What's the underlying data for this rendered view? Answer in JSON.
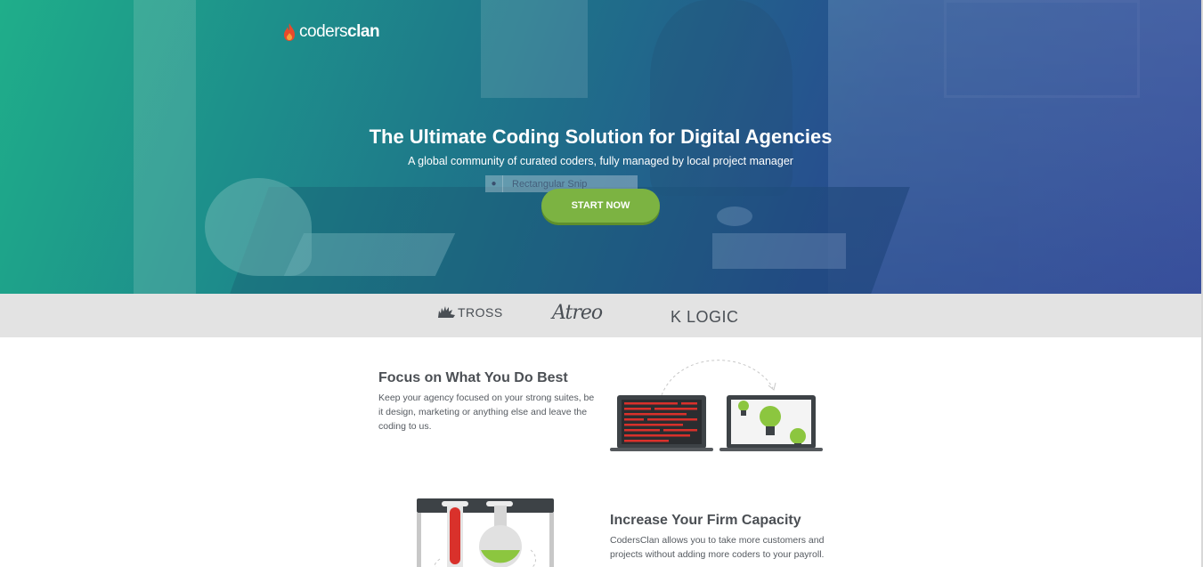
{
  "brand": {
    "logo_text_light": "coders",
    "logo_text_bold": "clan",
    "logo_icon": "flame-icon"
  },
  "hero": {
    "title": "The Ultimate Coding Solution for Digital Agencies",
    "subtitle": "A global community of curated coders, fully managed by local project manager",
    "cta_label": "START NOW",
    "snip_overlay_label": "Rectangular Snip",
    "colors": {
      "gradient_start": "#1fae8a",
      "gradient_end": "#2b3c94",
      "cta": "#7cb342"
    }
  },
  "clients": {
    "items": [
      {
        "name": "TROSS",
        "icon": "hedgehog-icon"
      },
      {
        "name": "Atreo"
      },
      {
        "name": "K LOGIC"
      }
    ]
  },
  "features": [
    {
      "title": "Focus on What You Do Best",
      "text": "Keep your agency focused on your strong suites, be it design, marketing or anything else and leave the coding to us.",
      "illustration": "laptops-code-to-ideas-illustration"
    },
    {
      "title": "Increase Your Firm Capacity",
      "text": "CodersClan allows you to take more customers and projects without adding more coders to your payroll.",
      "illustration": "lab-flask-tubes-illustration"
    }
  ]
}
